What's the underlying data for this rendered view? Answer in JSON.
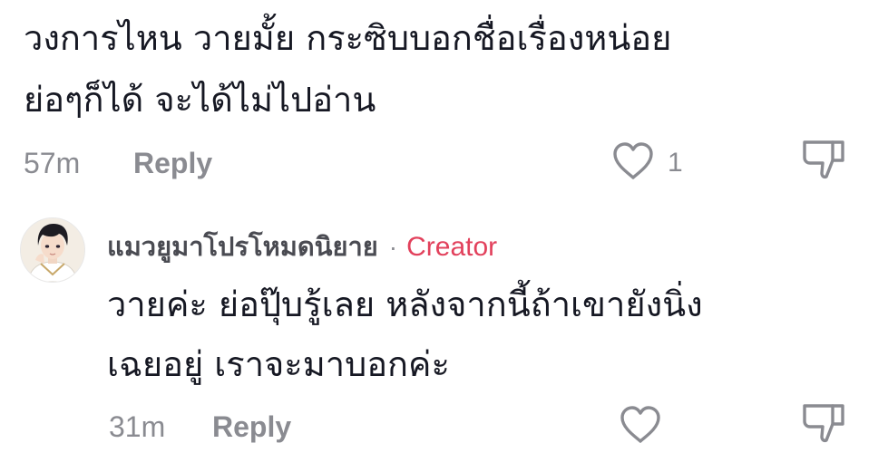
{
  "comments": [
    {
      "text_lines": [
        "วงการไหน วายมั้ย กระซิบบอกชื่อเรื่องหน่อย",
        "ย่อๆก็ได้ จะได้ไม่ไปอ่าน"
      ],
      "time": "57m",
      "reply_label": "Reply",
      "like_count": "1"
    },
    {
      "username": "แมวยูมาโปรโหมดนิยาย",
      "separator": "·",
      "badge": "Creator",
      "text_lines": [
        "วายค่ะ ย่อปุ๊บรู้เลย หลังจากนี้ถ้าเขายังนิ่ง",
        "เฉยอยู่ เราจะมาบอกค่ะ"
      ],
      "time": "31m",
      "reply_label": "Reply",
      "like_count": ""
    }
  ],
  "colors": {
    "text": "#161823",
    "meta": "#8a8b91",
    "creator": "#e2415c"
  },
  "icons": {
    "like": "heart-outline-icon",
    "dislike": "thumbs-down-outline-icon"
  }
}
